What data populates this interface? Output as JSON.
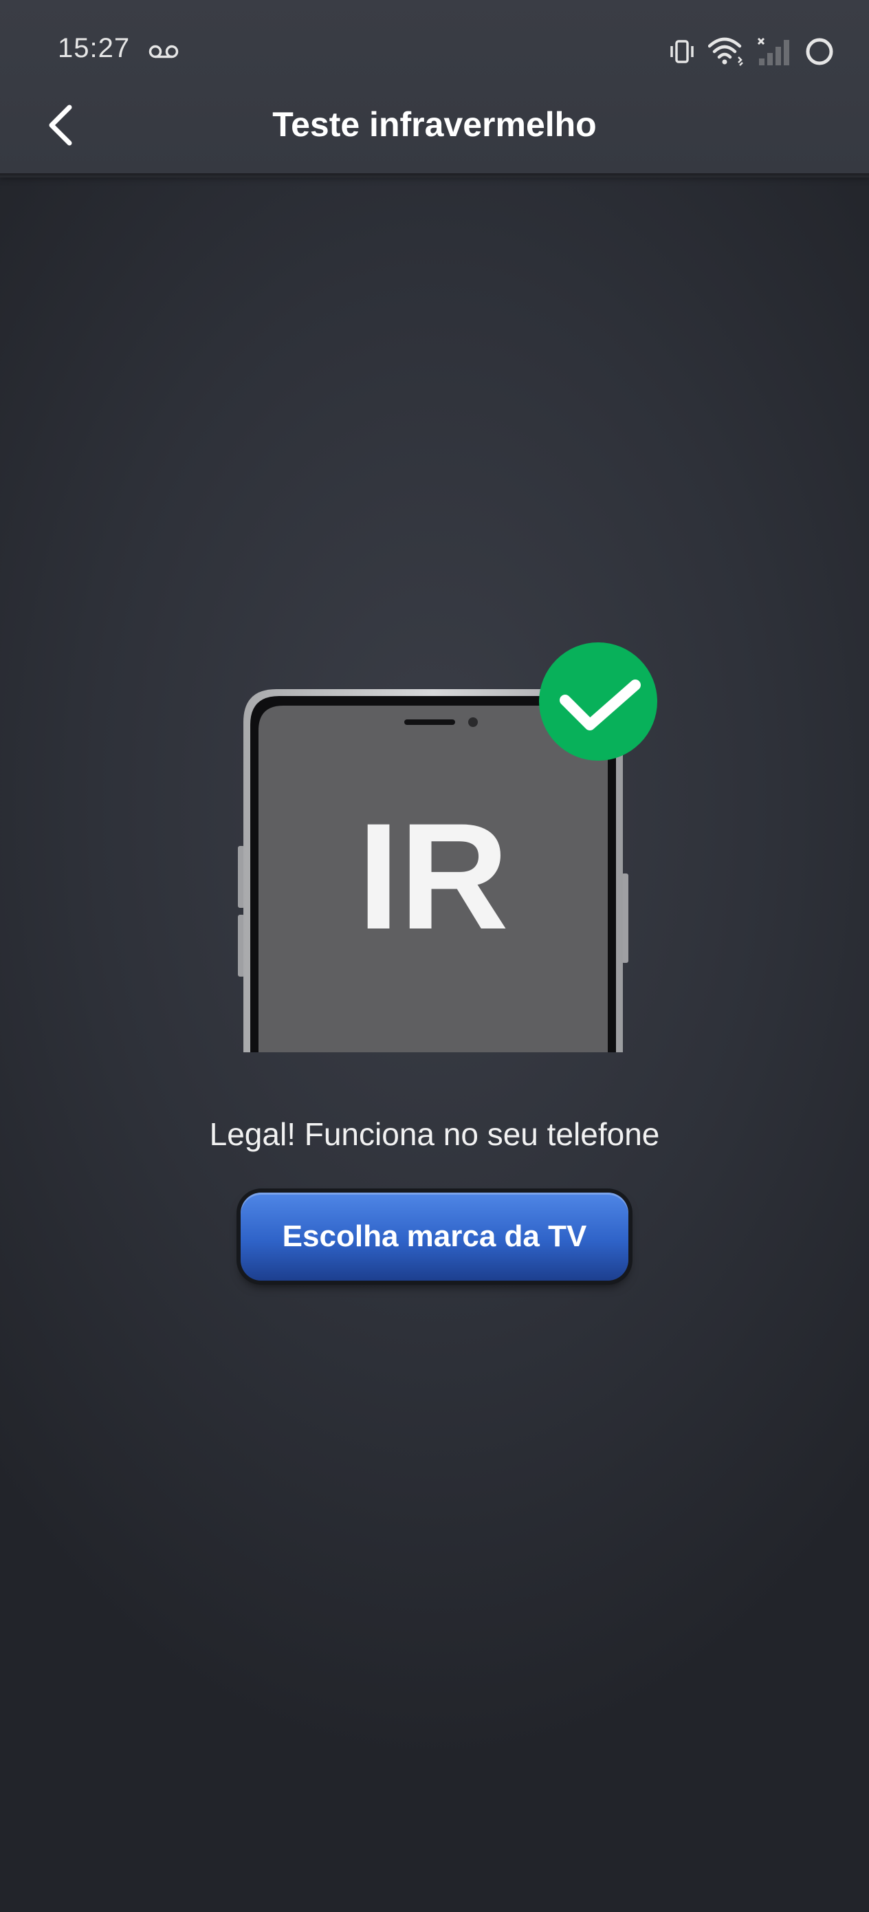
{
  "status_bar": {
    "time": "15:27",
    "icons": [
      "voicemail-icon",
      "vibrate-icon",
      "wifi-icon",
      "signal-off-icon",
      "loading-circle-icon"
    ]
  },
  "header": {
    "title": "Teste infravermelho",
    "back_icon": "chevron-left-icon"
  },
  "illustration": {
    "screen_text": "IR",
    "badge_icon": "checkmark-icon"
  },
  "main": {
    "message": "Legal! Funciona no seu telefone",
    "button_label": "Escolha marca da TV"
  },
  "colors": {
    "background": "#2e3139",
    "header": "#383b43",
    "success_green": "#08b15a",
    "button_blue": "#2f63c8",
    "phone_screen": "#5f5f61"
  }
}
